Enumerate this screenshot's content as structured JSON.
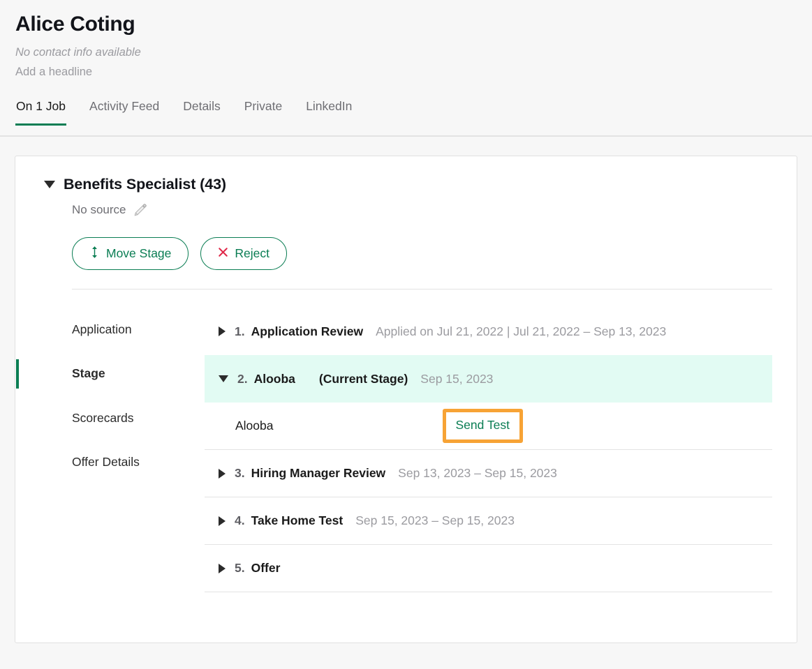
{
  "header": {
    "name": "Alice Coting",
    "contact_info": "No contact info available",
    "headline": "Add a headline"
  },
  "tabs": [
    {
      "label": "On 1 Job",
      "active": true
    },
    {
      "label": "Activity Feed",
      "active": false
    },
    {
      "label": "Details",
      "active": false
    },
    {
      "label": "Private",
      "active": false
    },
    {
      "label": "LinkedIn",
      "active": false
    }
  ],
  "job": {
    "title": "Benefits Specialist (43)",
    "source_label": "No source",
    "edit_source_icon": "pencil-icon",
    "collapse_icon": "caret-down-icon",
    "actions": [
      {
        "label": "Move Stage",
        "icon": "move-vertical-arrows-icon",
        "color": "#0a7d53"
      },
      {
        "label": "Reject",
        "icon": "close-x-icon",
        "color": "#0a7d53",
        "icon_color": "#e0294a"
      }
    ]
  },
  "side_nav": [
    {
      "label": "Application",
      "active": false
    },
    {
      "label": "Stage",
      "active": true
    },
    {
      "label": "Scorecards",
      "active": false
    },
    {
      "label": "Offer Details",
      "active": false
    }
  ],
  "stages": [
    {
      "number": "1.",
      "name": "Application Review",
      "dates": "Applied on Jul 21, 2022 | Jul 21, 2022 – Sep 13, 2023",
      "current_tag": "",
      "expanded": false,
      "current": false
    },
    {
      "number": "2.",
      "name": "Alooba",
      "dates": "Sep 15, 2023",
      "current_tag": "(Current Stage)",
      "expanded": true,
      "current": true
    },
    {
      "number": "3.",
      "name": "Hiring Manager Review",
      "dates": "Sep 13, 2023 – Sep 15, 2023",
      "current_tag": "",
      "expanded": false,
      "current": false
    },
    {
      "number": "4.",
      "name": "Take Home Test",
      "dates": "Sep 15, 2023 – Sep 15, 2023",
      "current_tag": "",
      "expanded": false,
      "current": false
    },
    {
      "number": "5.",
      "name": "Offer",
      "dates": "",
      "current_tag": "",
      "expanded": false,
      "current": false
    }
  ],
  "interview": {
    "name": "Alooba",
    "send_test_label": "Send Test",
    "highlight_color": "#f7a335"
  },
  "colors": {
    "accent_green": "#0a7d53",
    "current_stage_bg": "#e2fbf3",
    "reject_red": "#e0294a",
    "highlight_orange": "#f7a335",
    "page_bg": "#f7f7f7"
  }
}
